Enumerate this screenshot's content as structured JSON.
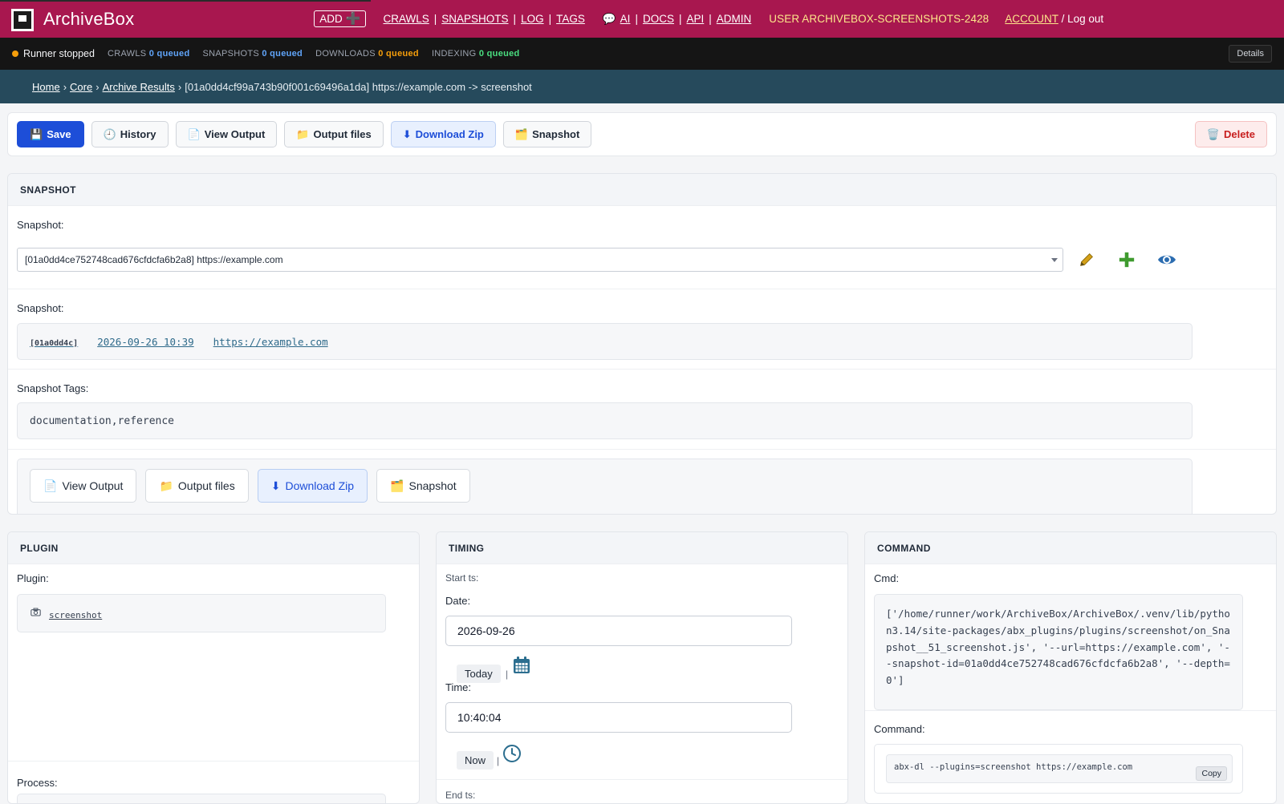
{
  "header": {
    "brand": "ArchiveBox",
    "add_label": "ADD",
    "nav1": [
      "CRAWLS",
      "SNAPSHOTS",
      "LOG",
      "TAGS"
    ],
    "nav2_prefix": "💬",
    "nav2": [
      "AI",
      "DOCS",
      "API",
      "ADMIN"
    ],
    "user_label": "USER ARCHIVEBOX-SCREENSHOTS-2428",
    "account_label": "ACCOUNT",
    "logout_label": " / Log out"
  },
  "status": {
    "runner": "Runner stopped",
    "crawls_label": "CRAWLS",
    "crawls_value": "0 queued",
    "snapshots_label": "SNAPSHOTS",
    "snapshots_value": "0 queued",
    "downloads_label": "DOWNLOADS",
    "downloads_value": "0 queued",
    "indexing_label": "INDEXING",
    "indexing_value": "0 queued",
    "details": "Details",
    "runner_color": "#f59e0b"
  },
  "breadcrumb": {
    "home": "Home",
    "core": "Core",
    "archive_results": "Archive Results",
    "current": "[01a0dd4cf99a743b90f001c69496a1da] https://example.com -> screenshot"
  },
  "toolbar": {
    "save": "Save",
    "history": "History",
    "view_output": "View Output",
    "output_files": "Output files",
    "download_zip": "Download Zip",
    "snapshot": "Snapshot",
    "delete": "Delete"
  },
  "snapshot_section": {
    "title": "SNAPSHOT",
    "snapshot_label": "Snapshot:",
    "snapshot_select": "[01a0dd4ce752748cad676cfdcfa6b2a8] https://example.com",
    "snapshot_label2": "Snapshot:",
    "link_id": "[01a0dd4c]",
    "link_date": "2026-09-26 10:39",
    "link_url": "https://example.com",
    "tags_label": "Snapshot Tags:",
    "tags_value": "documentation,reference",
    "view_output": "View Output",
    "output_files": "Output files",
    "download_zip": "Download Zip",
    "snapshot": "Snapshot"
  },
  "plugin_section": {
    "title": "PLUGIN",
    "plugin_label": "Plugin:",
    "plugin_name": "screenshot",
    "process_label": "Process:"
  },
  "timing_section": {
    "title": "TIMING",
    "start_label": "Start ts:",
    "date_label": "Date:",
    "date_value": "2026-09-26",
    "today": "Today",
    "time_label": "Time:",
    "time_value": "10:40:04",
    "now": "Now",
    "end_label": "End ts:"
  },
  "command_section": {
    "title": "COMMAND",
    "cmd_label": "Cmd:",
    "cmd_value": "['/home/runner/work/ArchiveBox/ArchiveBox/.venv/lib/python3.14/site-packages/abx_plugins/plugins/screenshot/on_Snapshot__51_screenshot.js', '--url=https://example.com', '--snapshot-id=01a0dd4ce752748cad676cfdcfa6b2a8', '--depth=0']",
    "command_label": "Command:",
    "command_value": "abx-dl --plugins=screenshot https://example.com",
    "copy": "Copy"
  },
  "colors": {
    "header_bg": "#a8174f",
    "breadcrumb_bg": "#264a5c",
    "primary": "#1d4ed8",
    "danger": "#c81e1e"
  }
}
